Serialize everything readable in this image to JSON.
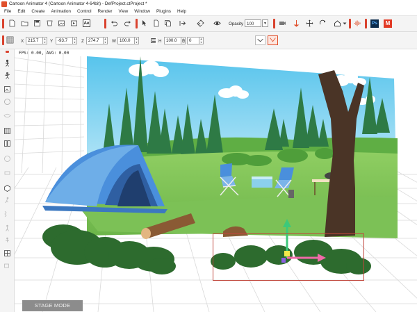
{
  "window": {
    "title": "Cartoon Animator 4  (Cartoon Animator 4-64bit) - DefProject.ctProject *"
  },
  "menu": [
    "File",
    "Edit",
    "Create",
    "Animation",
    "Control",
    "Render",
    "View",
    "Window",
    "Plugins",
    "Help"
  ],
  "toolbar": {
    "ae_label": "Ae",
    "opacity_label": "Opacity",
    "opacity_value": "100",
    "ps_label": "Ps",
    "m_label": "M"
  },
  "transform": {
    "x_label": "X",
    "x_value": "215.7",
    "y_label": "Y",
    "y_value": "-93.7",
    "z_label": "Z",
    "z_value": "274.7",
    "w_label": "W",
    "w_value": "100.0",
    "h_label": "H",
    "h_value": "100.0",
    "r_label": "R",
    "r_value": "0"
  },
  "viewport": {
    "fps_text": "FPS: 0.00, AVG: 0.00",
    "stage_mode_label": "STAGE MODE"
  },
  "colors": {
    "accent": "#e0502c",
    "sky_top": "#5cc8ec",
    "grass": "#7fc45a",
    "tent": "#4a8fdc"
  }
}
